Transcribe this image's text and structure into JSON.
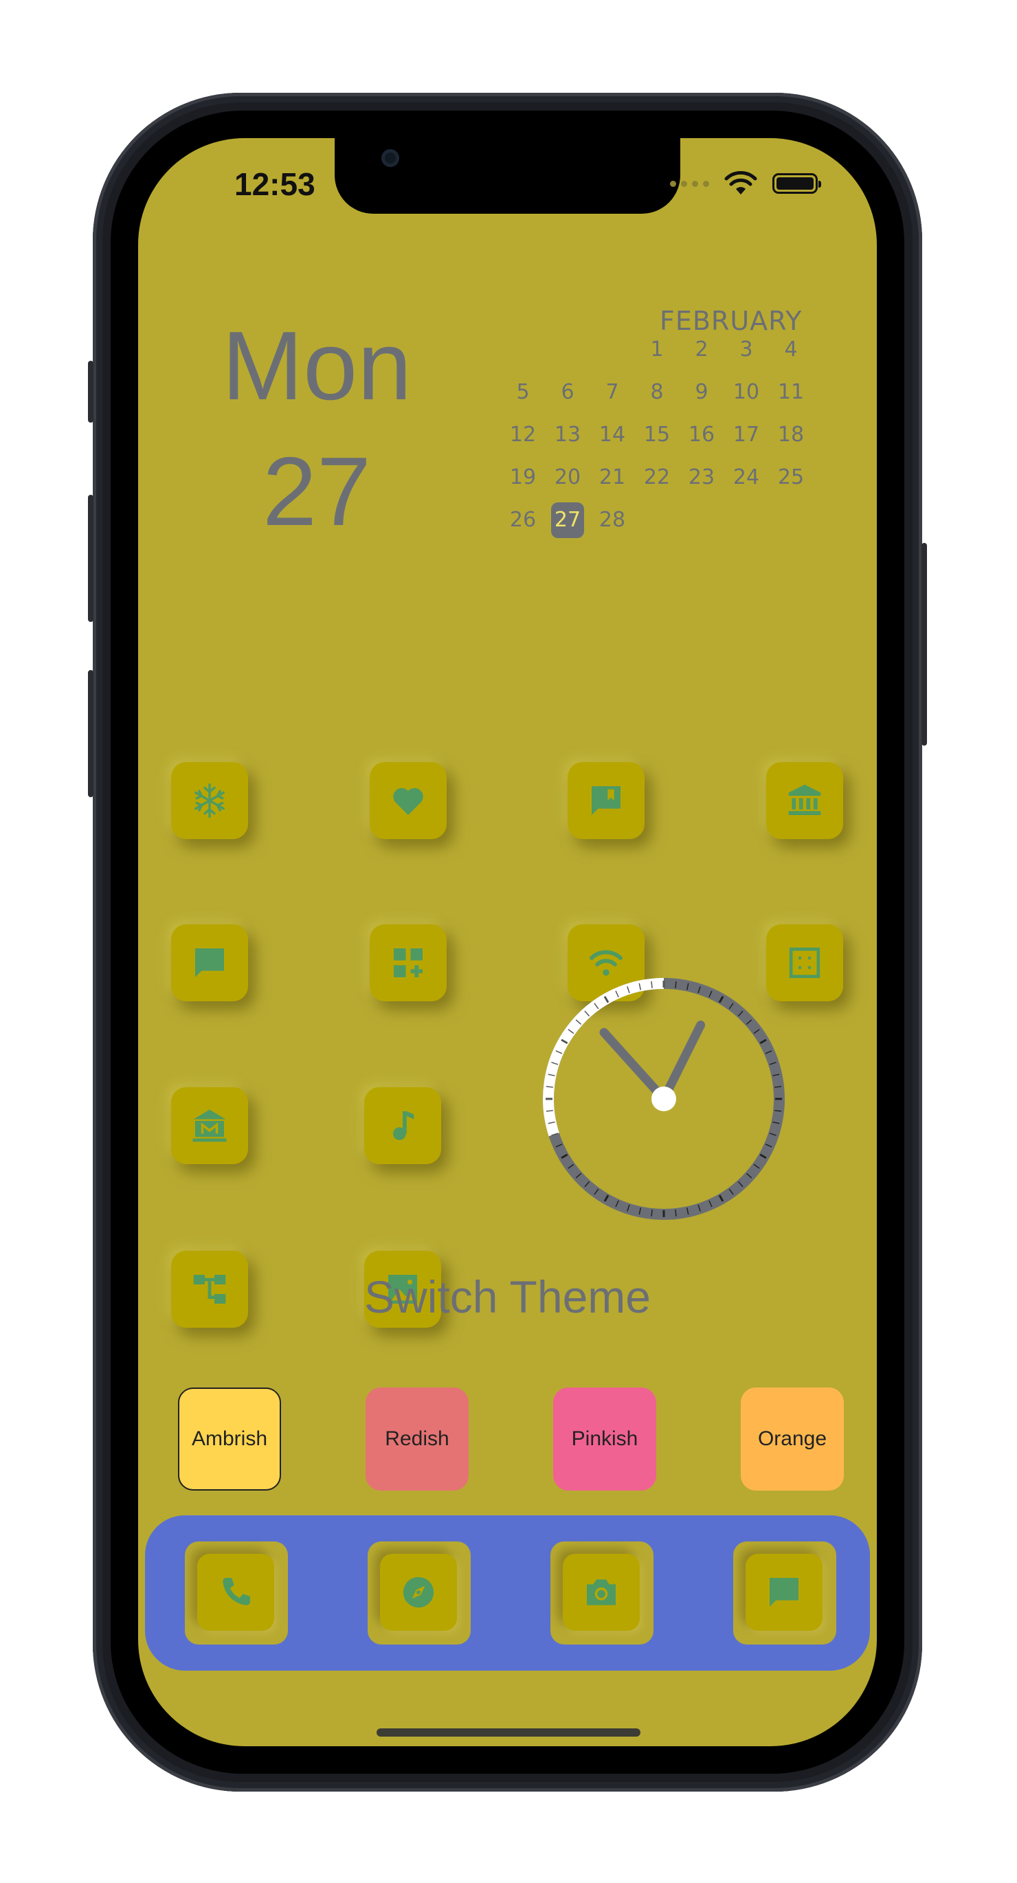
{
  "status_bar": {
    "time": "12:53"
  },
  "date_widget": {
    "weekday": "Mon",
    "day": "27"
  },
  "calendar": {
    "month": "FEBRUARY",
    "days": [
      "1",
      "2",
      "3",
      "4",
      "5",
      "6",
      "7",
      "8",
      "9",
      "10",
      "11",
      "12",
      "13",
      "14",
      "15",
      "16",
      "17",
      "18",
      "19",
      "20",
      "21",
      "22",
      "23",
      "24",
      "25",
      "26",
      "27",
      "28"
    ],
    "today": "27"
  },
  "apps": [
    {
      "icon": "snowflake-icon"
    },
    {
      "icon": "heart-icon"
    },
    {
      "icon": "rate-review-icon"
    },
    {
      "icon": "bank-icon"
    },
    {
      "icon": "chat-icon"
    },
    {
      "icon": "add-widget-icon"
    },
    {
      "icon": "wifi-icon"
    },
    {
      "icon": "crop-free-icon"
    },
    {
      "icon": "museum-icon"
    },
    {
      "icon": "music-note-icon"
    },
    {
      "icon": "account-tree-icon"
    },
    {
      "icon": "image-icon"
    }
  ],
  "clock": {
    "hour": 12,
    "minute": 53
  },
  "theme_switcher": {
    "title": "Switch Theme",
    "options": [
      {
        "label": "Ambrish",
        "color": "#ffd54f",
        "selected": true
      },
      {
        "label": "Redish",
        "color": "#e57373",
        "selected": false
      },
      {
        "label": "Pinkish",
        "color": "#f06292",
        "selected": false
      },
      {
        "label": "Orange",
        "color": "#ffb74d",
        "selected": false
      }
    ]
  },
  "dock": {
    "background": "#5a70d0",
    "apps": [
      {
        "icon": "phone-icon"
      },
      {
        "icon": "compass-icon"
      },
      {
        "icon": "camera-icon"
      },
      {
        "icon": "message-icon"
      }
    ]
  },
  "colors": {
    "screen_bg": "#b8aa31",
    "tile": "#b8a600",
    "icon": "#4e9a62",
    "text": "#6b6f75"
  }
}
